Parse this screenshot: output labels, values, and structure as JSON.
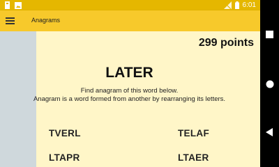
{
  "status_bar": {
    "time": "6:01",
    "icons": [
      "storage-icon",
      "image-notification-icon",
      "signal-off-icon",
      "battery-icon"
    ]
  },
  "app_bar": {
    "title": "Anagrams",
    "menu_icon": "hamburger-menu-icon"
  },
  "game": {
    "points": "299 points",
    "word": "LATER",
    "instruction_line1": "Find anagram of this word below.",
    "instruction_line2": "Anagram is a word formed from another by rearranging its letters.",
    "options": [
      "TVERL",
      "TELAF",
      "LTAPR",
      "LTAER"
    ]
  },
  "nav_bar": {
    "icons": [
      "recent-apps-icon",
      "home-icon",
      "back-icon"
    ]
  },
  "colors": {
    "status_bar": "#e5b700",
    "app_bar": "#f7c92b",
    "content_bg": "#fff6c8",
    "side_strip": "#cfd8dc"
  }
}
